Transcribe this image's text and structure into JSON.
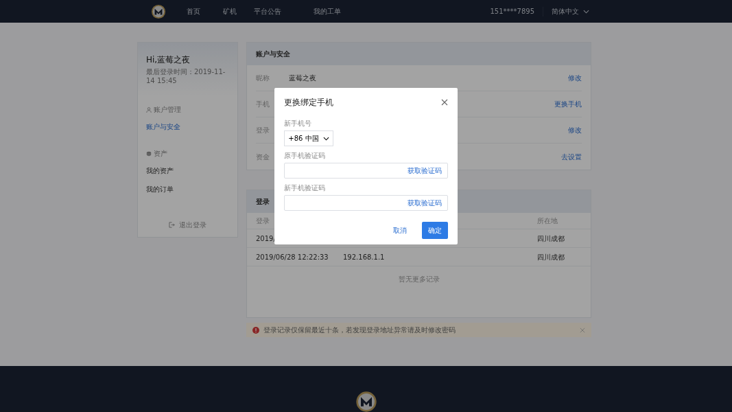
{
  "navbar": {
    "items": [
      {
        "label": "首页"
      },
      {
        "label": "矿机"
      },
      {
        "label": "平台公告"
      },
      {
        "label": "我的工单"
      }
    ],
    "phone": "151****7895",
    "language": "简体中文"
  },
  "sidebar": {
    "greeting": "Hi,蓝莓之夜",
    "last_login": "最后登录时间：2019-11-14 15:45",
    "sections": [
      {
        "title": "账户管理",
        "kind": "user",
        "items": [
          {
            "label": "账户与安全",
            "selected": true
          }
        ]
      },
      {
        "title": "资产",
        "kind": "asset",
        "items": [
          {
            "label": "我的资产",
            "selected": false
          },
          {
            "label": "我的订单",
            "selected": false
          }
        ]
      }
    ],
    "logout": "退出登录"
  },
  "account_card": {
    "title": "账户与安全",
    "rows": [
      {
        "label": "昵称",
        "value": "蓝莓之夜",
        "action": "修改"
      },
      {
        "label": "手机",
        "action": "更换手机"
      },
      {
        "label": "登录",
        "action": "修改"
      },
      {
        "label": "资金",
        "action": "去设置"
      }
    ]
  },
  "login_card": {
    "title": "登录",
    "columns": [
      "登录",
      "所在地"
    ],
    "rows": [
      {
        "time": "2019/",
        "location": "四川成都"
      },
      {
        "time": "2019/06/28 12:22:33",
        "ip": "192.168.1.1",
        "location": "四川成都"
      }
    ],
    "empty": "暂无更多记录"
  },
  "alert": {
    "text": "登录记录仅保留最近十条，若发现登录地址异常请及时修改密码",
    "closable": true
  },
  "modal": {
    "title": "更换绑定手机",
    "fields": [
      {
        "kind": "phone",
        "label": "新手机号",
        "country": "+86  中国"
      },
      {
        "kind": "code",
        "label": "原手机验证码",
        "action": "获取验证码"
      },
      {
        "kind": "code",
        "label": "新手机验证码",
        "action": "获取验证码"
      }
    ],
    "cancel": "取消",
    "confirm": "确定"
  }
}
